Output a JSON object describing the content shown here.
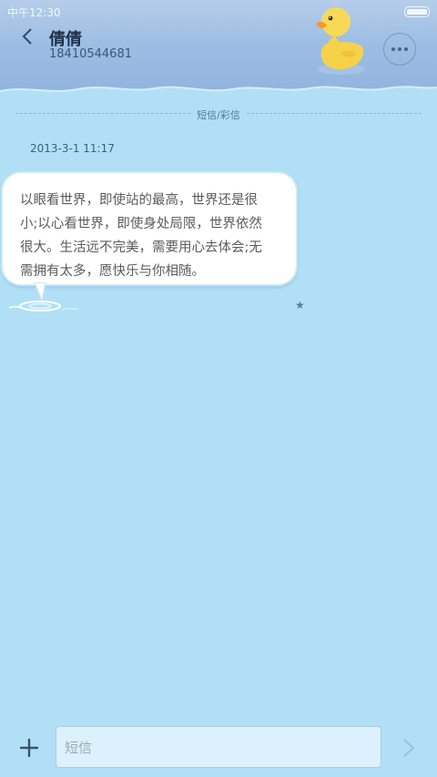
{
  "status_bar": {
    "time": "中午12:30"
  },
  "header": {
    "contact_name": "倩倩",
    "contact_number": "18410544681"
  },
  "conversation": {
    "divider_label": "短信/彩信",
    "messages": [
      {
        "timestamp": "2013-3-1 11:17",
        "lines": [
          "以眼看世界，即使站的最高，世界还是很",
          "小;以心看世界，即使身处局限，世界依然",
          "很大。生活远不完美，需要用心去体会;无",
          "需拥有太多，愿快乐与你相随。"
        ],
        "star": "★"
      }
    ]
  },
  "composer": {
    "placeholder": "短信"
  },
  "colors": {
    "background": "#b1e0f6",
    "header": "#9dbde3",
    "bubble": "#ffffff",
    "duck": "#f6d24a"
  }
}
